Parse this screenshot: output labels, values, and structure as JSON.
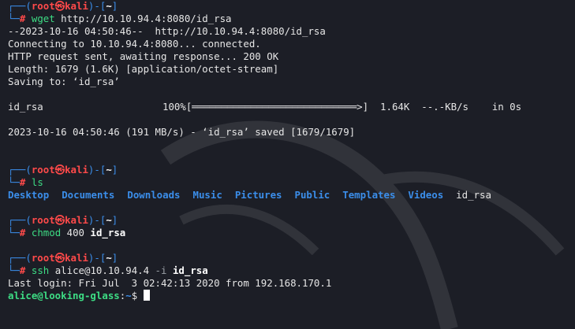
{
  "prompt": {
    "user": "root",
    "host": "kali",
    "at_symbol": "㉿",
    "dir": "~",
    "hash": "#"
  },
  "block1": {
    "cmd": "wget",
    "args": "http://10.10.94.4:8080/id_rsa",
    "out1": "--2023-10-16 04:50:46--  http://10.10.94.4:8080/id_rsa",
    "out2": "Connecting to 10.10.94.4:8080... connected.",
    "out3": "HTTP request sent, awaiting response... 200 OK",
    "out4": "Length: 1679 (1.6K) [application/octet-stream]",
    "out5": "Saving to: ‘id_rsa’",
    "progress": {
      "filename": "id_rsa",
      "percent": "100%",
      "bar": "[════════════════════════════>]",
      "size": "1.64K",
      "rate": "--.-KB/s",
      "eta": "in 0s"
    },
    "saved": "2023-10-16 04:50:46 (191 MB/s) - ‘id_rsa’ saved [1679/1679]"
  },
  "block2": {
    "cmd": "ls",
    "entries": [
      {
        "name": "Desktop",
        "type": "dir"
      },
      {
        "name": "Documents",
        "type": "dir"
      },
      {
        "name": "Downloads",
        "type": "dir"
      },
      {
        "name": "Music",
        "type": "dir"
      },
      {
        "name": "Pictures",
        "type": "dir"
      },
      {
        "name": "Public",
        "type": "dir"
      },
      {
        "name": "Templates",
        "type": "dir"
      },
      {
        "name": "Videos",
        "type": "dir"
      },
      {
        "name": "id_rsa",
        "type": "file"
      }
    ]
  },
  "block3": {
    "cmd": "chmod",
    "arg1": "400",
    "arg2": "id_rsa"
  },
  "block4": {
    "cmd": "ssh",
    "arg1": "alice@10.10.94.4",
    "flag": "-i",
    "arg2": "id_rsa",
    "lastlogin": "Last login: Fri Jul  3 02:42:13 2020 from 192.168.170.1",
    "remote_userhost": "alice@looking-glass",
    "remote_colon": ":",
    "remote_dir": "~",
    "remote_sym": "$"
  },
  "colors": {
    "background": "#1c1e26",
    "prompt_box": "#3b8eea",
    "prompt_user": "#ff4a4a",
    "command": "#3ddc84",
    "directory": "#3b8eea"
  }
}
